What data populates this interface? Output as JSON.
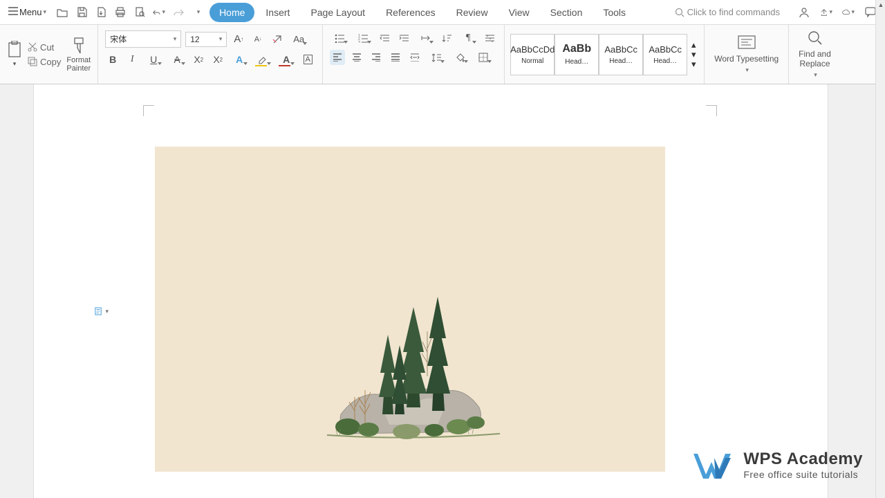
{
  "menu": {
    "label": "Menu",
    "tabs": [
      "Home",
      "Insert",
      "Page Layout",
      "References",
      "Review",
      "View",
      "Section",
      "Tools"
    ],
    "active_tab": "Home",
    "search_placeholder": "Click to find commands"
  },
  "clipboard": {
    "cut": "Cut",
    "copy": "Copy",
    "format_painter": "Format\nPainter"
  },
  "font": {
    "name": "宋体",
    "size": "12"
  },
  "styles": [
    {
      "preview": "AaBbCcDd",
      "name": "Normal"
    },
    {
      "preview": "AaBb",
      "name": "Head…"
    },
    {
      "preview": "AaBbCc",
      "name": "Head…"
    },
    {
      "preview": "AaBbCc",
      "name": "Head…"
    }
  ],
  "word_typesetting": "Word Typesetting",
  "find_replace": "Find and\nReplace",
  "watermark": {
    "title": "WPS Academy",
    "subtitle": "Free office suite tutorials"
  },
  "colors": {
    "font_color": "#c0392b",
    "highlight": "#f1c40f",
    "border_accent": "#4a9ed8"
  }
}
